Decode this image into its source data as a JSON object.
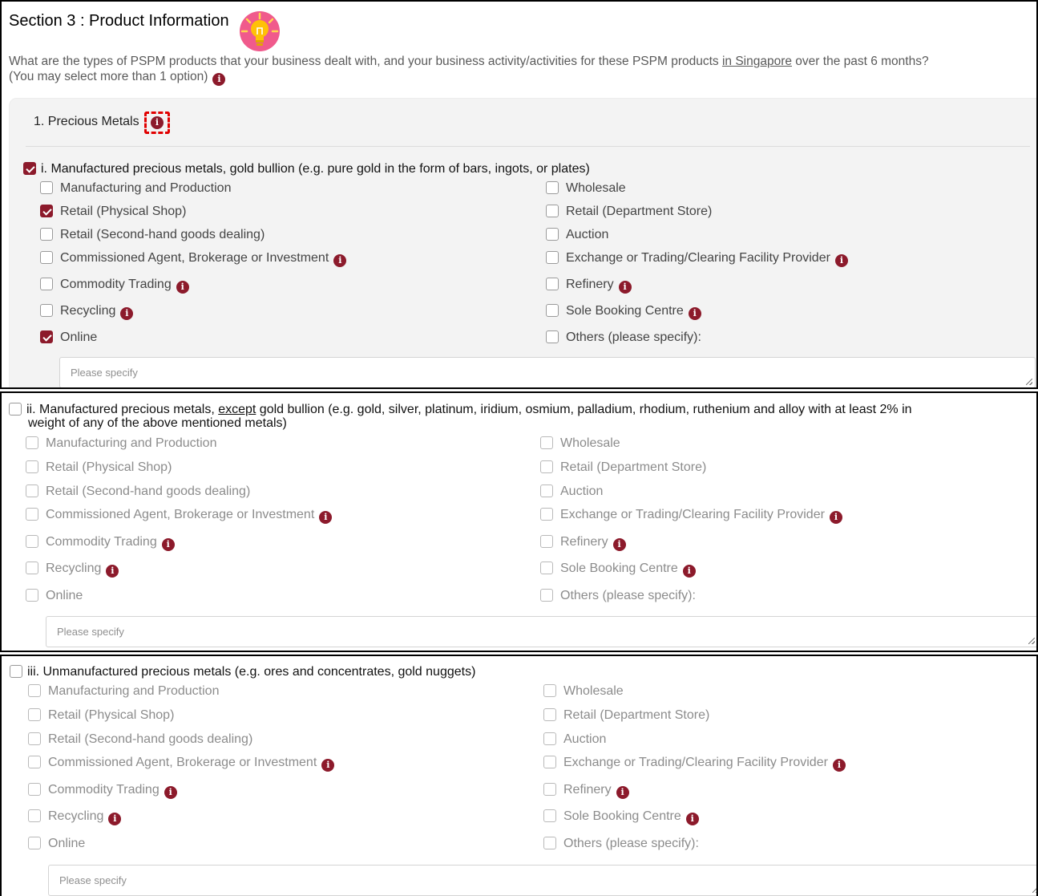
{
  "section": {
    "title": "Section 3 : Product Information",
    "question_part1": "What are the types of PSPM products that your business dealt with, and your business activity/activities for these PSPM products ",
    "question_link": "in Singapore",
    "question_part2": " over the past 6 months?",
    "question_line2": "(You may select more than 1 option)",
    "group_title": "1. Precious Metals",
    "info_glyph": "i"
  },
  "specify_placeholder": "Please specify",
  "categories": [
    {
      "title": "i. Manufactured precious metals, gold bullion (e.g. pure gold in the form of bars, ingots, or plates)",
      "checked": true,
      "options": {
        "manufacturing": "Manufacturing and Production",
        "retail_physical": "Retail (Physical Shop)",
        "retail_second_hand": "Retail (Second-hand goods dealing)",
        "commissioned": "Commissioned Agent, Brokerage or Investment",
        "commodity": "Commodity Trading",
        "recycling": "Recycling",
        "online": "Online",
        "wholesale": "Wholesale",
        "retail_department": "Retail (Department Store)",
        "auction": "Auction",
        "exchange": "Exchange or Trading/Clearing Facility Provider",
        "refinery": "Refinery",
        "sole_booking": "Sole Booking Centre",
        "others": "Others (please specify):"
      },
      "checked_options": [
        "retail_physical",
        "online"
      ]
    },
    {
      "title_pre": "ii. Manufactured precious metals, ",
      "title_underline": "except",
      "title_post": " gold bullion (e.g. gold, silver, platinum, iridium, osmium, palladium, rhodium, ruthenium and alloy with at least 2% in",
      "title_line2": "weight of any of the above mentioned metals)",
      "checked": false,
      "options": {
        "manufacturing": "Manufacturing and Production",
        "retail_physical": "Retail (Physical Shop)",
        "retail_second_hand": "Retail (Second-hand goods dealing)",
        "commissioned": "Commissioned Agent, Brokerage or Investment",
        "commodity": "Commodity Trading",
        "recycling": "Recycling",
        "online": "Online",
        "wholesale": "Wholesale",
        "retail_department": "Retail (Department Store)",
        "auction": "Auction",
        "exchange": "Exchange or Trading/Clearing Facility Provider",
        "refinery": "Refinery",
        "sole_booking": "Sole Booking Centre",
        "others": "Others (please specify):"
      }
    },
    {
      "title": "iii. Unmanufactured precious metals (e.g. ores and concentrates, gold nuggets)",
      "checked": false,
      "options": {
        "manufacturing": "Manufacturing and Production",
        "retail_physical": "Retail (Physical Shop)",
        "retail_second_hand": "Retail (Second-hand goods dealing)",
        "commissioned": "Commissioned Agent, Brokerage or Investment",
        "commodity": "Commodity Trading",
        "recycling": "Recycling",
        "online": "Online",
        "wholesale": "Wholesale",
        "retail_department": "Retail (Department Store)",
        "auction": "Auction",
        "exchange": "Exchange or Trading/Clearing Facility Provider",
        "refinery": "Refinery",
        "sole_booking": "Sole Booking Centre",
        "others": "Others (please specify):"
      }
    }
  ],
  "colors": {
    "accent": "#8c1a2b",
    "highlight": "#e10000",
    "bulb_bg": "#f05a8c",
    "bulb": "#ffc107"
  },
  "icons": [
    "lightbulb-icon",
    "info-icon",
    "checkbox"
  ]
}
